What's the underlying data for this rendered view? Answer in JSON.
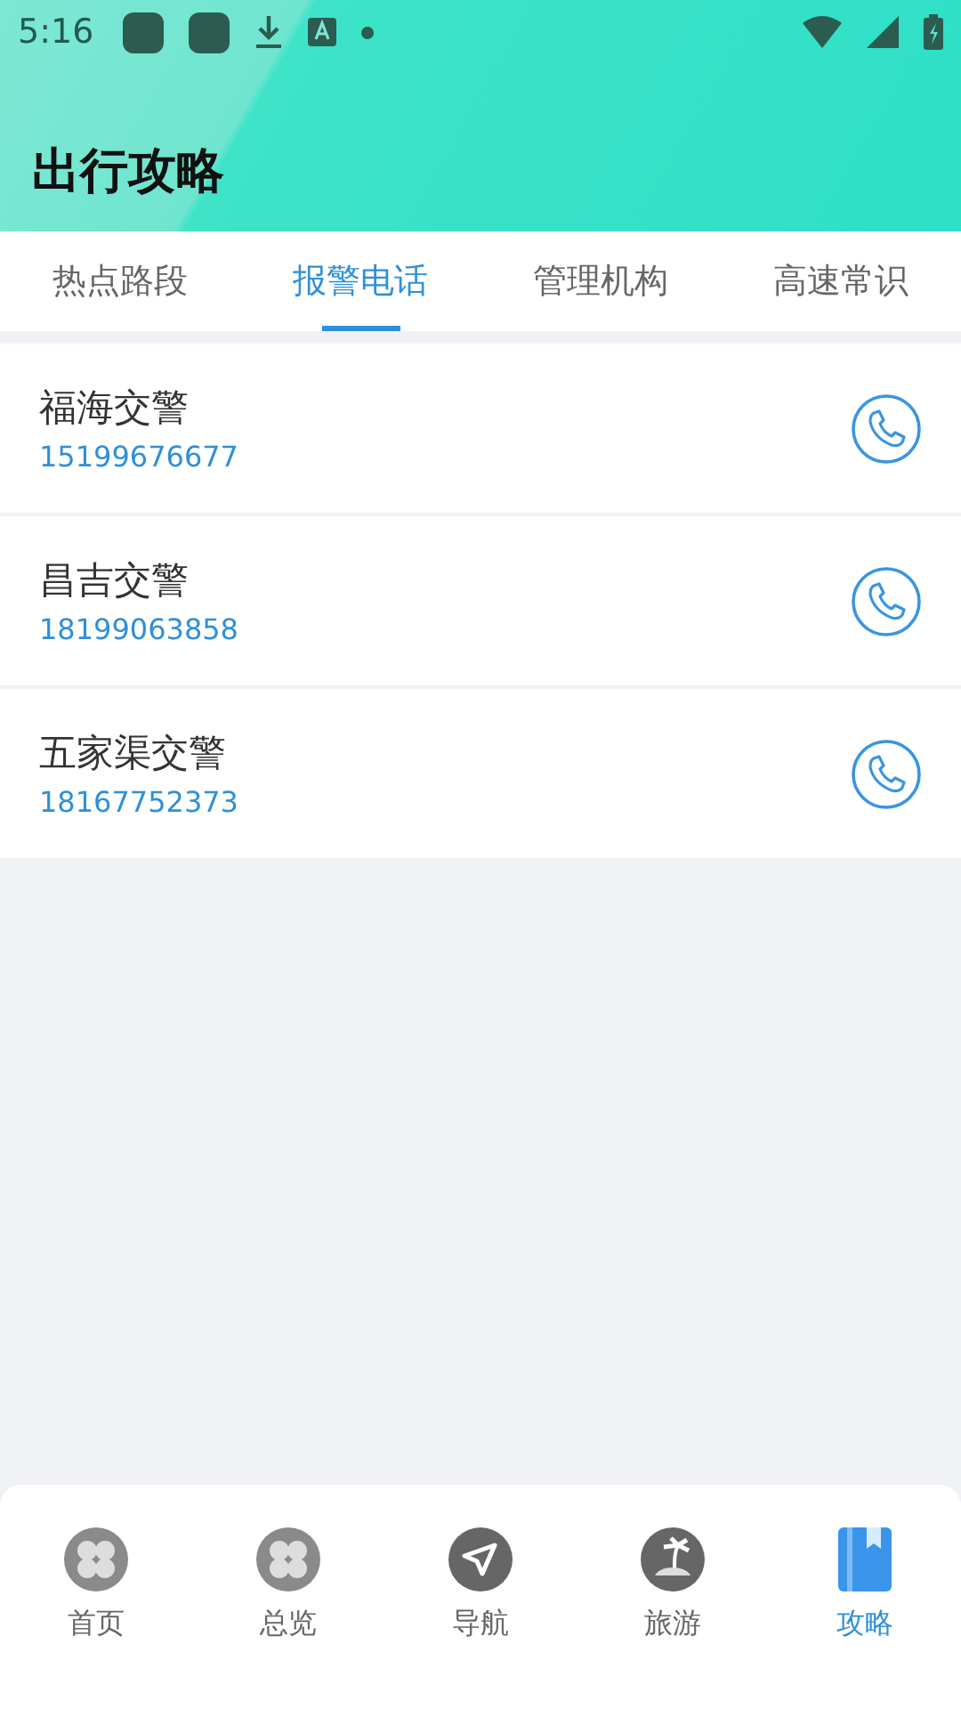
{
  "status_bar": {
    "time": "5:16"
  },
  "header": {
    "title": "出行攻略"
  },
  "tabs": [
    {
      "label": "热点路段",
      "selected": false
    },
    {
      "label": "报警电话",
      "selected": true
    },
    {
      "label": "管理机构",
      "selected": false
    },
    {
      "label": "高速常识",
      "selected": false
    }
  ],
  "contacts": [
    {
      "name": "福海交警",
      "phone": "15199676677"
    },
    {
      "name": "昌吉交警",
      "phone": "18199063858"
    },
    {
      "name": "五家渠交警",
      "phone": "18167752373"
    }
  ],
  "bottom_nav": [
    {
      "label": "首页",
      "kind": "clover",
      "selected": false
    },
    {
      "label": "总览",
      "kind": "clover",
      "selected": false
    },
    {
      "label": "导航",
      "kind": "navigate",
      "selected": false
    },
    {
      "label": "旅游",
      "kind": "island",
      "selected": false
    },
    {
      "label": "攻略",
      "kind": "book",
      "selected": true
    }
  ]
}
